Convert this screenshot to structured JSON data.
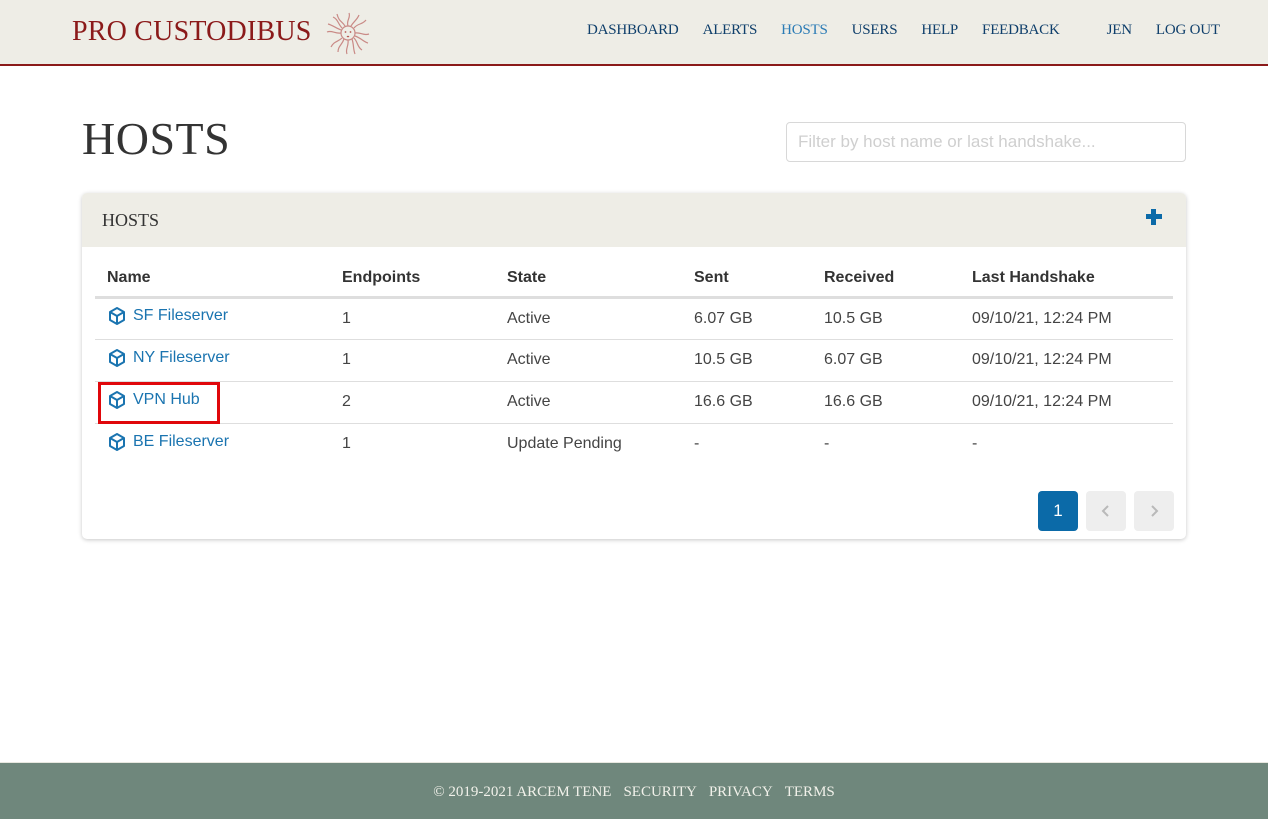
{
  "header": {
    "brand": "PRO CUSTODIBUS",
    "logo_icon": "medusa-logo-icon",
    "nav": [
      {
        "label": "DASHBOARD",
        "active": false
      },
      {
        "label": "ALERTS",
        "active": false
      },
      {
        "label": "HOSTS",
        "active": true
      },
      {
        "label": "USERS",
        "active": false
      },
      {
        "label": "HELP",
        "active": false
      },
      {
        "label": "FEEDBACK",
        "active": false
      }
    ],
    "user": "JEN",
    "logout": "LOG OUT"
  },
  "page": {
    "title": "HOSTS",
    "filter": {
      "value": "",
      "placeholder": "Filter by host name or last handshake..."
    }
  },
  "card": {
    "title": "HOSTS",
    "add_icon": "plus-icon",
    "columns": [
      "Name",
      "Endpoints",
      "State",
      "Sent",
      "Received",
      "Last Handshake"
    ],
    "rows": [
      {
        "name": "SF Fileserver",
        "endpoints": "1",
        "state": "Active",
        "sent": "6.07 GB",
        "received": "10.5 GB",
        "last_handshake": "09/10/21, 12:24 PM"
      },
      {
        "name": "NY Fileserver",
        "endpoints": "1",
        "state": "Active",
        "sent": "10.5 GB",
        "received": "6.07 GB",
        "last_handshake": "09/10/21, 12:24 PM"
      },
      {
        "name": "VPN Hub",
        "endpoints": "2",
        "state": "Active",
        "sent": "16.6 GB",
        "received": "16.6 GB",
        "last_handshake": "09/10/21, 12:24 PM"
      },
      {
        "name": "BE Fileserver",
        "endpoints": "1",
        "state": "Update Pending",
        "sent": "-",
        "received": "-",
        "last_handshake": "-"
      }
    ],
    "pagination": {
      "current": "1",
      "prev_icon": "chevron-left-icon",
      "next_icon": "chevron-right-icon"
    }
  },
  "footer": {
    "copyright": "© 2019-2021 ARCEM TENE",
    "links": [
      "SECURITY",
      "PRIVACY",
      "TERMS"
    ]
  },
  "colors": {
    "brand": "#8b1a1a",
    "link": "#1a74b0",
    "active_nav": "#2b7bb5",
    "state_active": "#4e8a2f",
    "state_pending": "#d4b21b",
    "primary_button": "#0b6aa8",
    "footer_bg": "#6f877c",
    "header_bg": "#eeede6",
    "highlight": "#e0070b"
  }
}
